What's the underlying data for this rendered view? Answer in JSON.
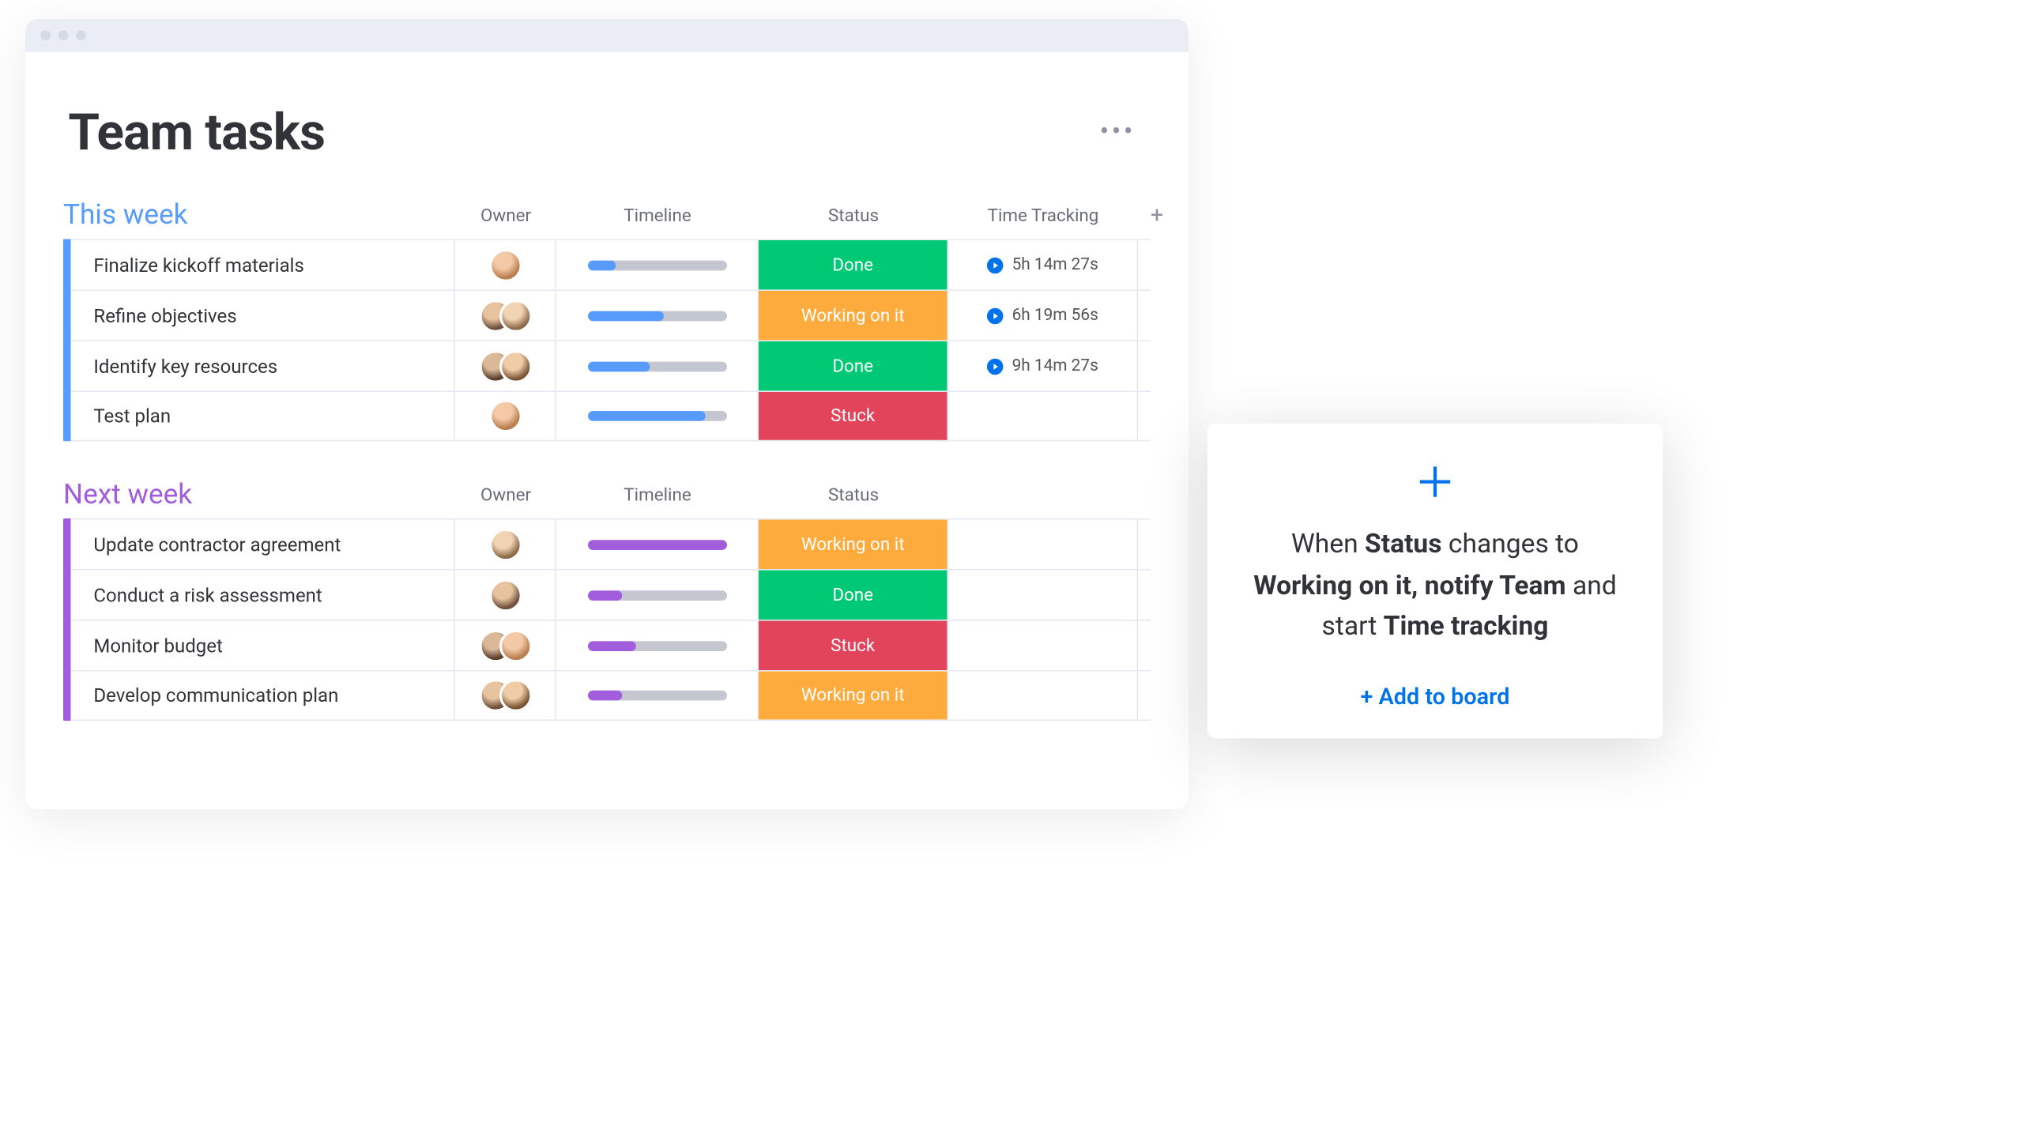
{
  "page": {
    "title": "Team tasks"
  },
  "columns": {
    "owner": "Owner",
    "timeline": "Timeline",
    "status": "Status",
    "time_tracking": "Time Tracking"
  },
  "groups": [
    {
      "id": "this_week",
      "title": "This week",
      "color": "blue",
      "show_time_tracking": true,
      "rows": [
        {
          "name": "Finalize kickoff materials",
          "owners": [
            "a"
          ],
          "progress": 20,
          "status": "Done",
          "status_class": "done",
          "time": "5h 14m 27s"
        },
        {
          "name": "Refine objectives",
          "owners": [
            "b",
            "c"
          ],
          "progress": 55,
          "status": "Working on it",
          "status_class": "working",
          "time": "6h 19m 56s"
        },
        {
          "name": "Identify key resources",
          "owners": [
            "d",
            "e"
          ],
          "progress": 45,
          "status": "Done",
          "status_class": "done",
          "time": "9h 14m 27s"
        },
        {
          "name": "Test plan",
          "owners": [
            "a"
          ],
          "progress": 85,
          "status": "Stuck",
          "status_class": "stuck",
          "time": ""
        }
      ]
    },
    {
      "id": "next_week",
      "title": "Next week",
      "color": "purple",
      "show_time_tracking": false,
      "rows": [
        {
          "name": "Update contractor agreement",
          "owners": [
            "c"
          ],
          "progress": 100,
          "status": "Working on it",
          "status_class": "working",
          "time": ""
        },
        {
          "name": "Conduct a risk assessment",
          "owners": [
            "b"
          ],
          "progress": 25,
          "status": "Done",
          "status_class": "done",
          "time": ""
        },
        {
          "name": "Monitor budget",
          "owners": [
            "d",
            "a"
          ],
          "progress": 35,
          "status": "Stuck",
          "status_class": "stuck",
          "time": ""
        },
        {
          "name": "Develop communication plan",
          "owners": [
            "b",
            "e"
          ],
          "progress": 25,
          "status": "Working on it",
          "status_class": "working",
          "time": ""
        }
      ]
    }
  ],
  "modal": {
    "text_parts": [
      "When ",
      "Status",
      " changes to ",
      "Working on it, notify Team",
      " and start ",
      "Time tracking"
    ],
    "action": "+ Add to board"
  }
}
